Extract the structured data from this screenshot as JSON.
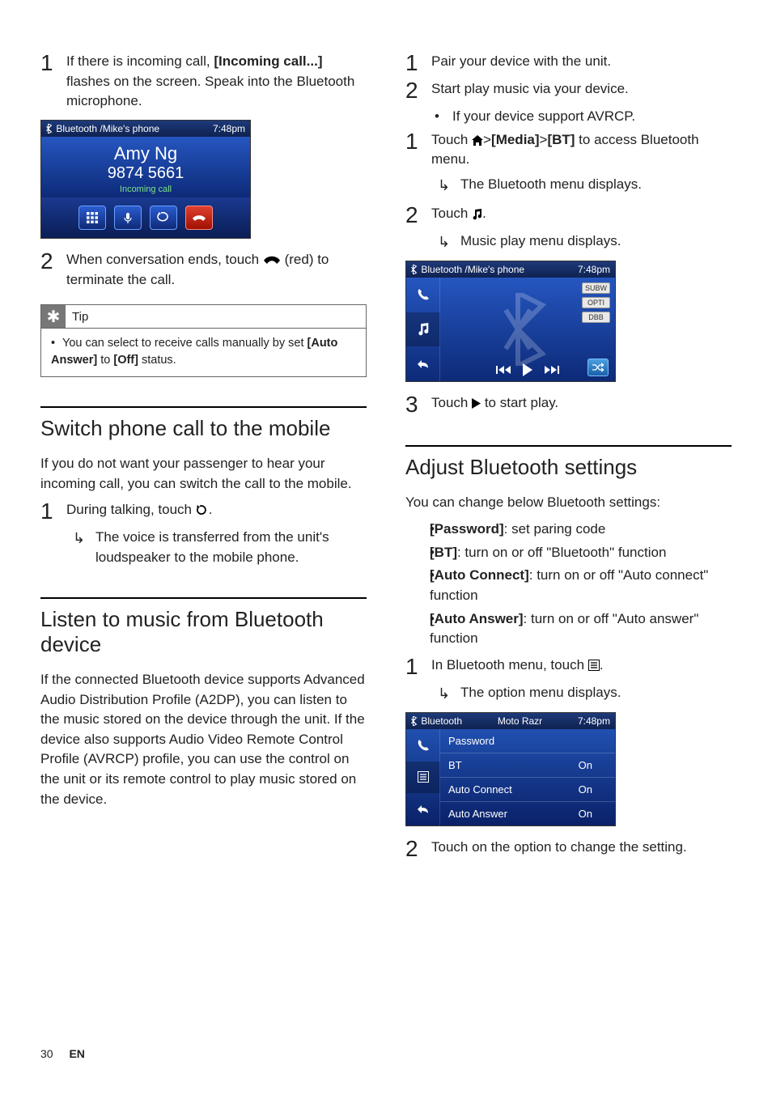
{
  "left": {
    "step1": {
      "pre": "If there is incoming call, ",
      "bold": "[Incoming call...]",
      "post": " flashes on the screen. Speak into the Bluetooth microphone."
    },
    "shot1": {
      "header_left": "Bluetooth /Mike's phone",
      "header_right": "7:48pm",
      "name": "Amy Ng",
      "number": "9874 5661",
      "status": "Incoming call"
    },
    "step2": {
      "pre": "When conversation ends, touch ",
      "post": " (red) to terminate the call."
    },
    "tip": {
      "label": "Tip",
      "body_pre": "You can select to receive calls manually by set ",
      "b1": "[Auto Answer]",
      "mid": " to ",
      "b2": "[Off]",
      "post": " status."
    },
    "sec2_title": "Switch phone call to the mobile",
    "sec2_para": "If you do not want your passenger to hear your incoming call, you can switch the call to the mobile.",
    "sec2_step1_pre": "During talking, touch ",
    "sec2_step1_post": ".",
    "sec2_sub": "The voice is transferred from the unit's loudspeaker to the mobile phone.",
    "sec3_title": "Listen to music from Bluetooth device",
    "sec3_para": "If the connected Bluetooth device supports Advanced Audio Distribution Profile (A2DP), you can listen to the music stored on the device through the unit. If the device also supports Audio Video Remote Control Profile (AVRCP) profile, you can use the control on the unit or its remote control to play music stored on the device."
  },
  "right": {
    "r1": "Pair your device with the unit.",
    "r2": "Start play music via your device.",
    "rb1": "If your device support AVRCP.",
    "rs1_pre": "Touch ",
    "rs1_b1": "[Media]",
    "rs1_b2": "[BT]",
    "rs1_post": " to access Bluetooth menu.",
    "rs1_sub": "The Bluetooth menu displays.",
    "rs2_pre": "Touch ",
    "rs2_post": ".",
    "rs2_sub": "Music play menu displays.",
    "shot2": {
      "header_left": "Bluetooth /Mike's phone",
      "header_right": "7:48pm",
      "badge1": "SUBW",
      "badge2": "OPTI",
      "badge3": "DBB"
    },
    "rs3_pre": "Touch ",
    "rs3_post": " to start play.",
    "sec4_title": "Adjust Bluetooth settings",
    "sec4_para": "You can change below Bluetooth settings:",
    "opts": {
      "o1b": "[Password]",
      "o1": ": set paring code",
      "o2b": "[BT]",
      "o2": ": turn on or off \"Bluetooth\" function",
      "o3b": "[Auto Connect]",
      "o3": ": turn on or off \"Auto connect\" function",
      "o4b": "[Auto Answer]",
      "o4": ": turn on or off \"Auto answer\" function"
    },
    "s4_step1_pre": "In Bluetooth menu, touch ",
    "s4_step1_post": ".",
    "s4_step1_sub": "The option menu displays.",
    "shot3": {
      "header_left": "Bluetooth",
      "header_mid": "Moto Razr",
      "header_right": "7:48pm",
      "r1a": "Password",
      "r1b": "",
      "r2a": "BT",
      "r2b": "On",
      "r3a": "Auto Connect",
      "r3b": "On",
      "r4a": "Auto Answer",
      "r4b": "On"
    },
    "s4_step2": "Touch on the option to change the setting."
  },
  "footer": {
    "page": "30",
    "lang": "EN"
  }
}
